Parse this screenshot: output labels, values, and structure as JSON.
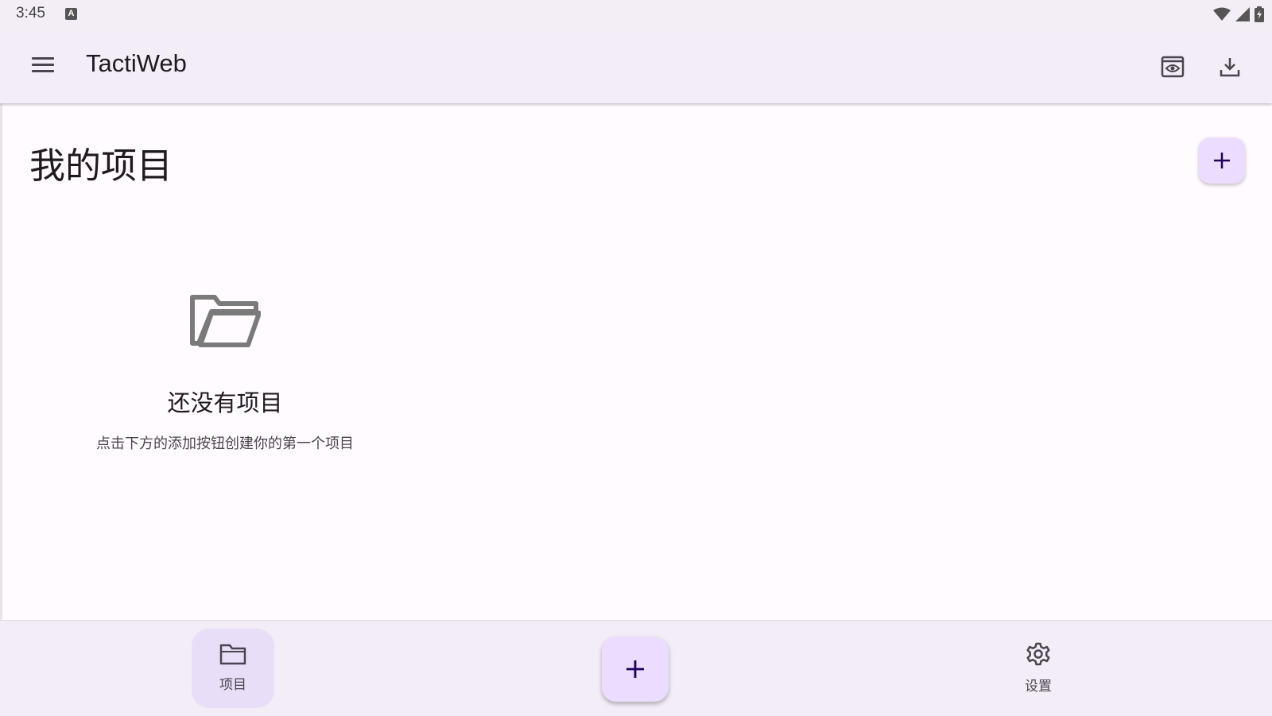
{
  "status_bar": {
    "time": "3:45",
    "notification_icon_letter": "A",
    "icons": [
      "wifi-icon",
      "cellular-signal-icon",
      "battery-icon"
    ]
  },
  "app_bar": {
    "title": "TactiWeb",
    "icons": [
      "menu-icon",
      "preview-icon",
      "download-icon"
    ]
  },
  "main": {
    "page_title": "我的项目",
    "add_button_icon": "plus-icon",
    "empty_state": {
      "icon": "folder-open-icon",
      "title": "还没有项目",
      "description": "点击下方的添加按钮创建你的第一个项目"
    }
  },
  "bottom_nav": {
    "items": [
      {
        "label": "项目",
        "icon": "folder-icon",
        "selected": true
      },
      {
        "label": "设置",
        "icon": "gear-icon",
        "selected": false
      }
    ],
    "center_fab_icon": "plus-icon"
  },
  "colors": {
    "primary_container": "#eaddff",
    "secondary_container": "#e8def8",
    "surface": "#fffbfe",
    "surface_container": "#f3edf7",
    "on_surface": "#1d1b20",
    "on_surface_variant": "#49454f",
    "icon_grey": "#7a7a7a"
  }
}
